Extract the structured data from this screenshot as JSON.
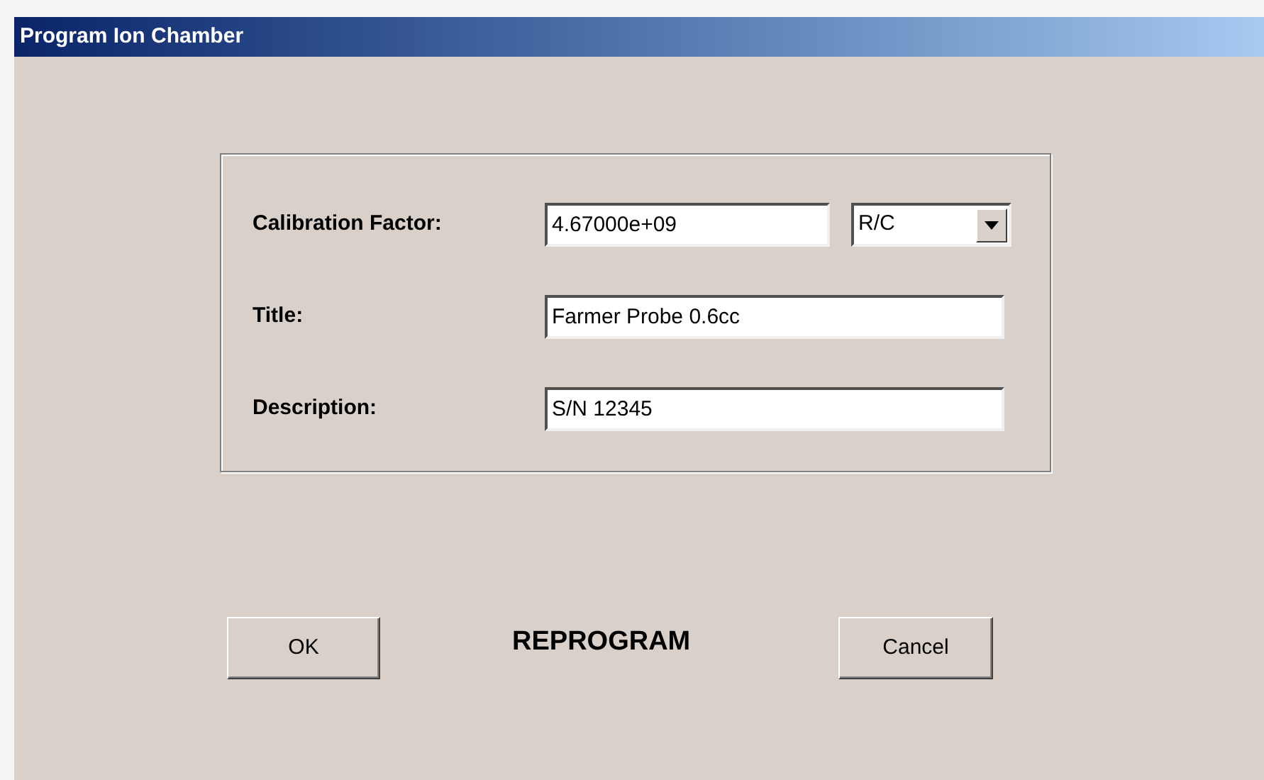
{
  "window": {
    "title": "Program Ion Chamber"
  },
  "fields": [
    {
      "label": "Calibration Factor:",
      "value": "4.67000e+09",
      "kind": "text_with_unit",
      "unit": "R/C"
    },
    {
      "label": "Title:",
      "value": "Farmer Probe 0.6cc",
      "kind": "text"
    },
    {
      "label": "Description:",
      "value": "S/N 12345",
      "kind": "text"
    }
  ],
  "status": "REPROGRAM",
  "buttons": [
    {
      "label": "OK"
    },
    {
      "label": "Cancel"
    }
  ]
}
